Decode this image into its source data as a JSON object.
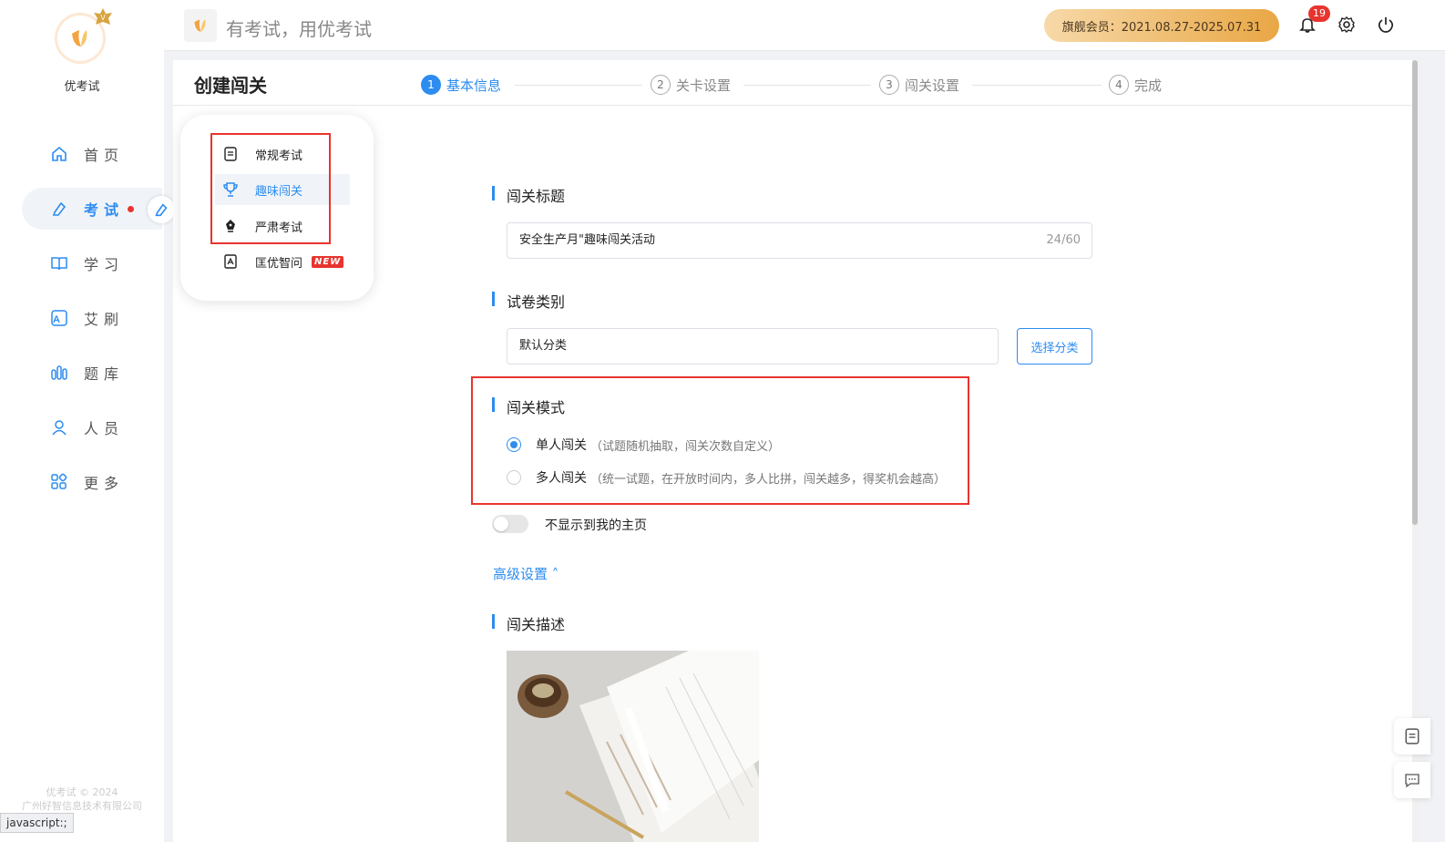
{
  "app": {
    "name": "优考试",
    "slogan": "有考试，用优考试"
  },
  "sidebar": {
    "items": [
      {
        "label": "首页",
        "icon": "home-icon"
      },
      {
        "label": "考试",
        "icon": "exam-icon"
      },
      {
        "label": "学习",
        "icon": "book-icon"
      },
      {
        "label": "艾刷",
        "icon": "a-icon"
      },
      {
        "label": "题库",
        "icon": "bank-icon"
      },
      {
        "label": "人员",
        "icon": "user-icon"
      },
      {
        "label": "更多",
        "icon": "more-icon"
      }
    ],
    "footer_line1": "优考试 © 2024",
    "footer_line2": "广州好智信息技术有限公司"
  },
  "status_url": "javascript:;",
  "header": {
    "member_text": "旗舰会员：2021.08.27-2025.07.31",
    "notification_count": "19"
  },
  "page": {
    "title": "创建闯关",
    "steps": [
      {
        "num": "1",
        "label": "基本信息"
      },
      {
        "num": "2",
        "label": "关卡设置"
      },
      {
        "num": "3",
        "label": "闯关设置"
      },
      {
        "num": "4",
        "label": "完成"
      }
    ]
  },
  "popup_menu": {
    "items": [
      {
        "label": "常规考试"
      },
      {
        "label": "趣味闯关"
      },
      {
        "label": "严肃考试"
      },
      {
        "label": "匡优智问",
        "tag": "NEW"
      }
    ]
  },
  "form": {
    "title_section": "闯关标题",
    "title_value": "安全生产月\"趣味闯关活动",
    "title_count": "24/60",
    "category_section": "试卷类别",
    "category_value": "默认分类",
    "choose_category": "选择分类",
    "mode_section": "闯关模式",
    "mode_single": "单人闯关",
    "mode_single_desc": "（试题随机抽取，闯关次数自定义）",
    "mode_multi": "多人闯关",
    "mode_multi_desc": "（统一试题，在开放时间内，多人比拼，闯关越多，得奖机会越高）",
    "toggle_label": "不显示到我的主页",
    "advanced": "高级设置 ˄",
    "desc_section": "闯关描述"
  },
  "colors": {
    "primary": "#2d8cf0",
    "highlight": "#e8342e"
  }
}
